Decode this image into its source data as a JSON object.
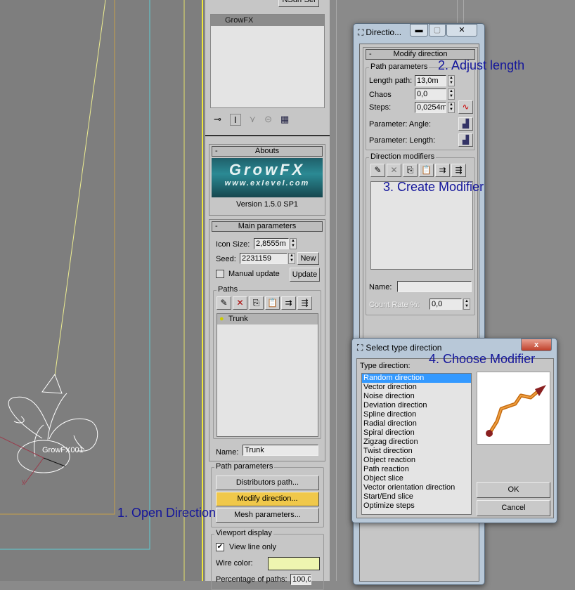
{
  "viewport": {
    "object_label": "GrowFX001",
    "axis_label": "y"
  },
  "command_panel": {
    "top_button": "NSurf Sel",
    "modifier_stack": {
      "items": [
        "GrowFX"
      ]
    },
    "abouts": {
      "title": "Abouts",
      "logo": "GrowFX",
      "logo_url": "www.exlevel.com",
      "version": "Version 1.5.0 SP1"
    },
    "main_parameters": {
      "title": "Main parameters",
      "icon_size_label": "Icon Size:",
      "icon_size_value": "2,8555m",
      "seed_label": "Seed:",
      "seed_value": "2231159",
      "new_button": "New",
      "manual_update_label": "Manual update",
      "manual_update_checked": false,
      "update_button": "Update"
    },
    "paths": {
      "title": "Paths",
      "items": [
        "Trunk"
      ],
      "name_label": "Name:",
      "name_value": "Trunk"
    },
    "path_parameters": {
      "title": "Path parameters",
      "distributors_button": "Distributors path...",
      "modify_direction_button": "Modify direction...",
      "mesh_button": "Mesh parameters..."
    },
    "viewport_display": {
      "title": "Viewport display",
      "view_line_only_label": "View line only",
      "view_line_only_checked": true,
      "wire_color_label": "Wire color:",
      "wire_color": "#eef5b0",
      "percentage_label": "Percentage of paths:",
      "percentage_value": "100,0"
    }
  },
  "direction_window": {
    "title": "Directio...",
    "rollout_title": "Modify direction",
    "path_parameters": {
      "title": "Path parameters",
      "length_label": "Length path:",
      "length_value": "13,0m",
      "chaos_label": "Chaos",
      "chaos_value": "0,0",
      "steps_label": "Steps:",
      "steps_value": "0,0254m",
      "angle_label": "Parameter: Angle:",
      "length_param_label": "Parameter: Length:"
    },
    "direction_modifiers": {
      "title": "Direction modifiers",
      "name_label": "Name:",
      "name_value": "",
      "count_rate_label": "Count Rate %:",
      "count_rate_value": "0,0"
    }
  },
  "select_dialog": {
    "title": "Select type direction",
    "list_label": "Type direction:",
    "items": [
      "Random direction",
      "Vector direction",
      "Noise direction",
      "Deviation direction",
      "Spline direction",
      "Radial direction",
      "Spiral direction",
      "Zigzag direction",
      "Twist direction",
      "Object reaction",
      "Path reaction",
      "Object slice",
      "Vector orientation direction",
      "Start/End slice",
      "Optimize steps"
    ],
    "selected_index": 0,
    "ok_button": "OK",
    "cancel_button": "Cancel",
    "close_button": "x"
  },
  "annotations": {
    "step1": "1. Open Direction",
    "step2": "2. Adjust length",
    "step3": "3. Create Modifier",
    "step4": "4. Choose Modifier"
  },
  "colors": {
    "highlight_button": "#f0c84a",
    "annotation": "#14169b",
    "selection": "#3399ff"
  }
}
